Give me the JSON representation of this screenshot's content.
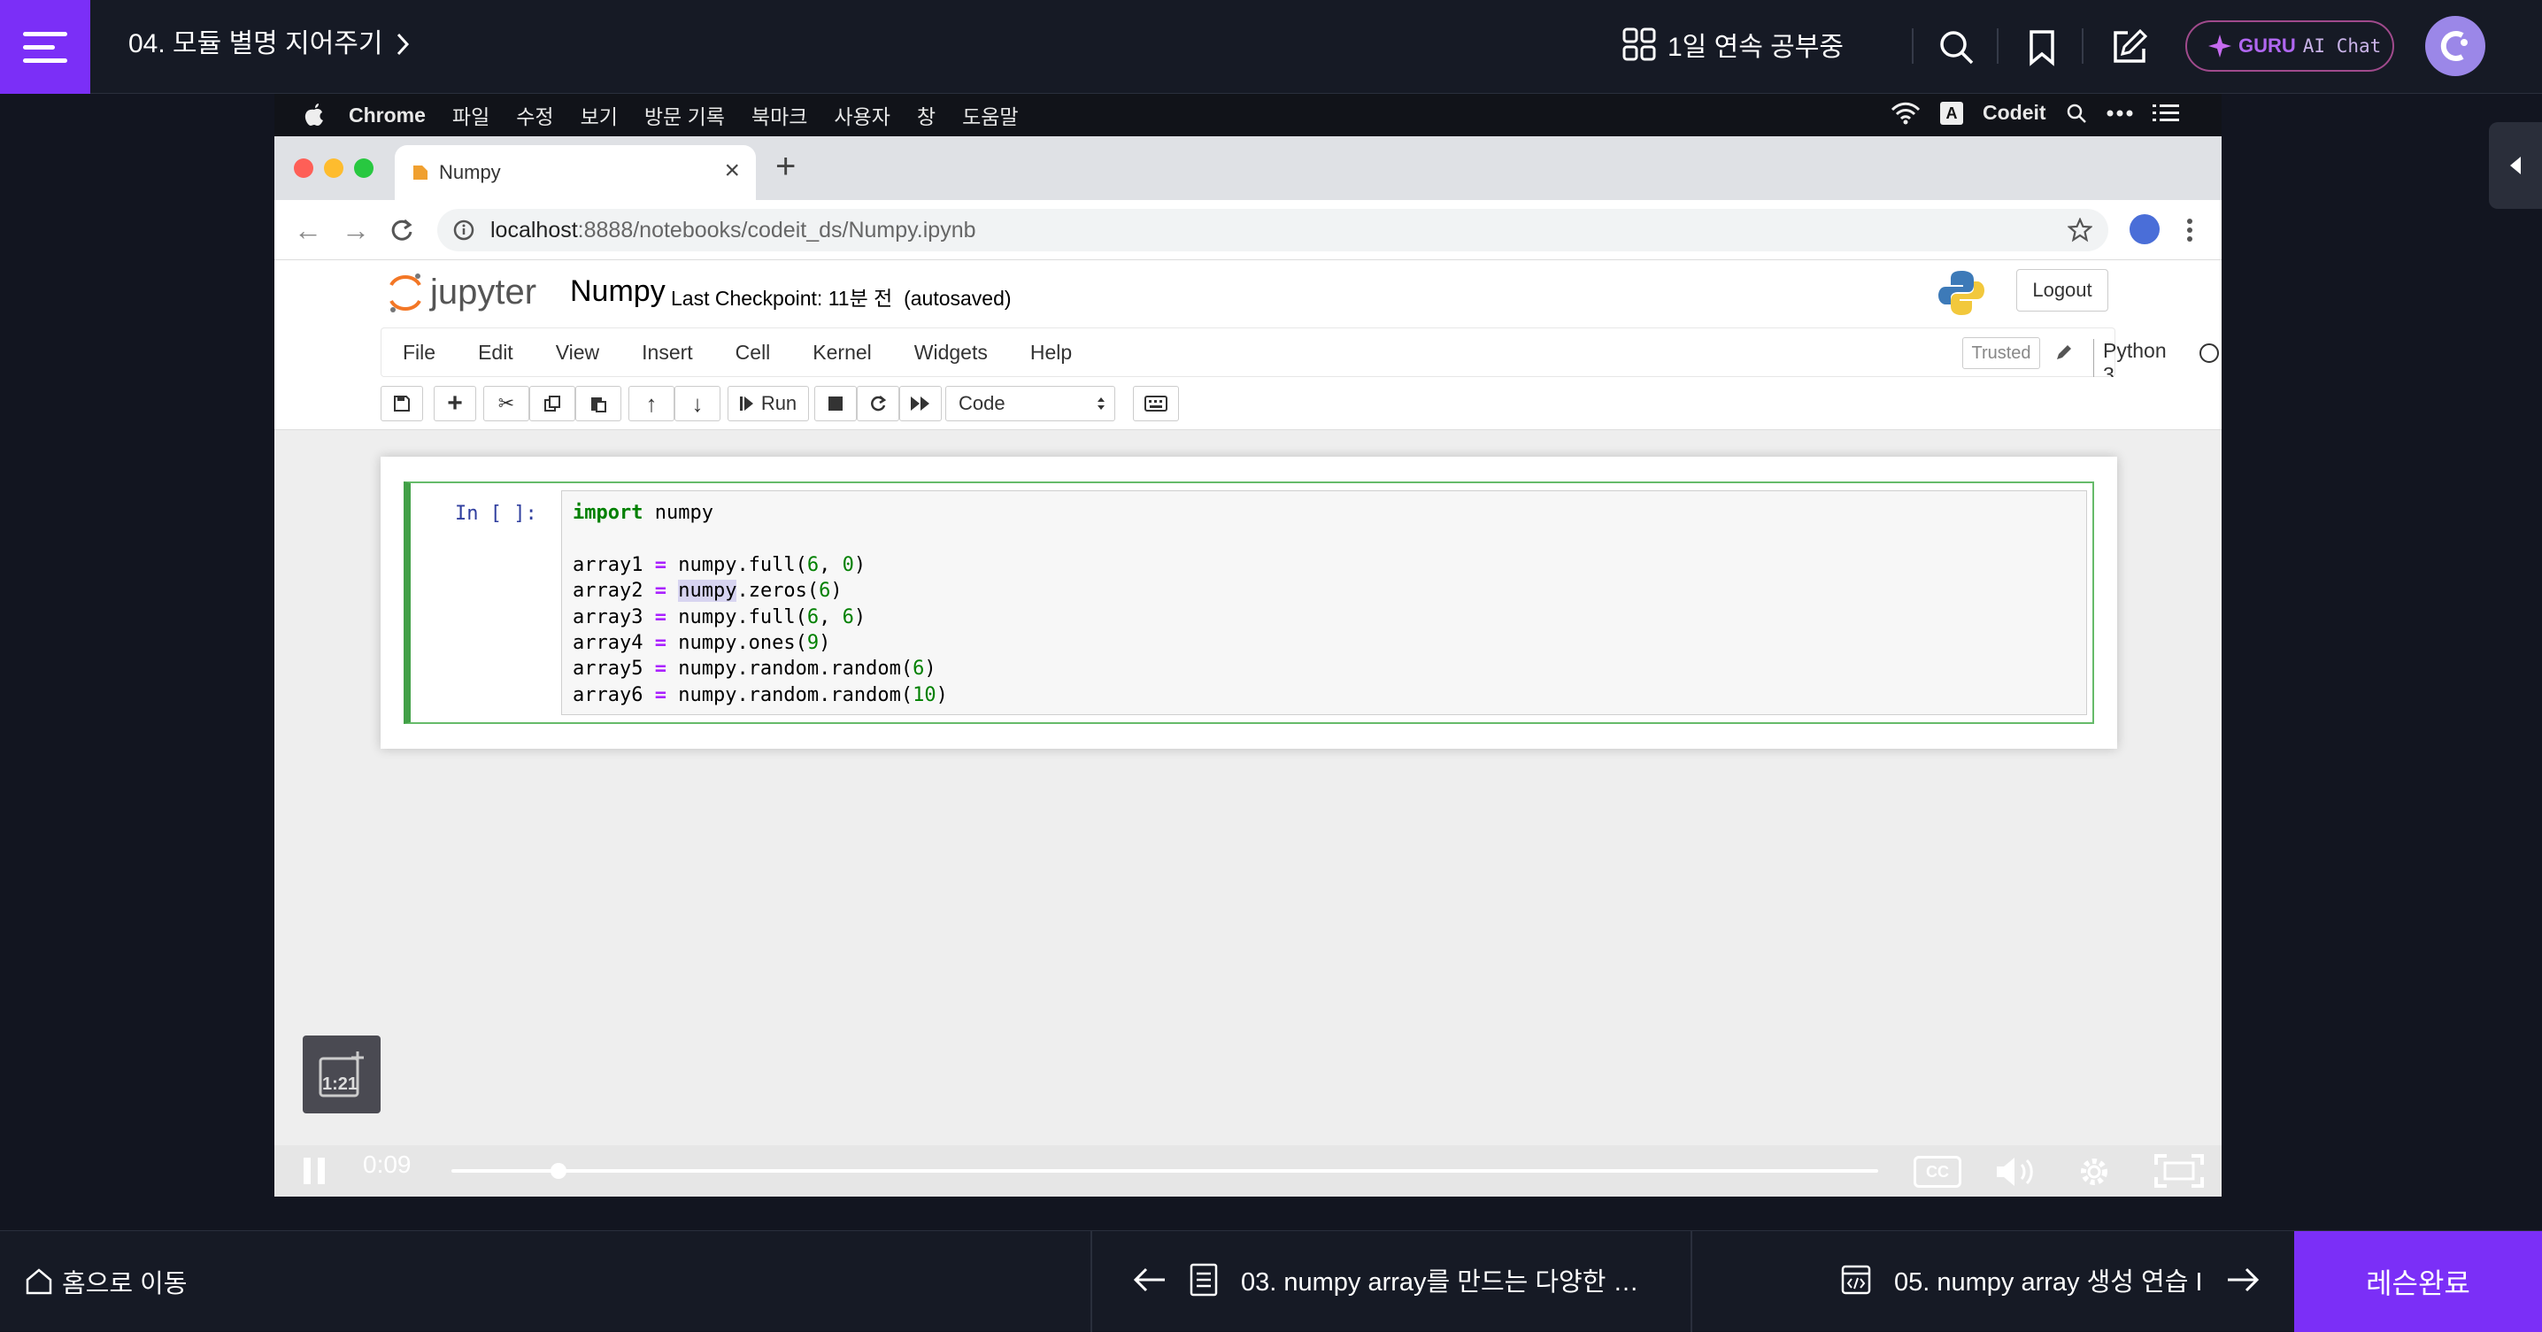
{
  "topbar": {
    "lesson_title": "04. 모듈 별명 지어주기",
    "streak": "1일 연속 공부중",
    "guru_brand": "GURU",
    "guru_label": "AI Chat"
  },
  "macbar": {
    "app": "Chrome",
    "menus": [
      "파일",
      "수정",
      "보기",
      "방문 기록",
      "북마크",
      "사용자",
      "창",
      "도움말"
    ],
    "right_label": "Codeit",
    "input_icon": "A"
  },
  "browser": {
    "tab_title": "Numpy",
    "url_host": "localhost",
    "url_path": ":8888/notebooks/codeit_ds/Numpy.ipynb"
  },
  "jupyter": {
    "logo_text": "jupyter",
    "notebook_name": "Numpy",
    "checkpoint": "Last Checkpoint: 11분 전",
    "autosaved": "(autosaved)",
    "logout": "Logout",
    "menus": [
      "File",
      "Edit",
      "View",
      "Insert",
      "Cell",
      "Kernel",
      "Widgets",
      "Help"
    ],
    "trusted": "Trusted",
    "kernel": "Python 3",
    "run_label": "Run",
    "cell_type": "Code",
    "prompt": "In [ ]:",
    "code_lines": [
      "import numpy",
      "",
      "array1 = numpy.full(6, 0)",
      "array2 = numpy.zeros(6)",
      "array3 = numpy.full(6, 6)",
      "array4 = numpy.ones(9)",
      "array5 = numpy.random.random(6)",
      "array6 = numpy.random.random(10)"
    ]
  },
  "video": {
    "time": "0:09",
    "thumb_time": "1:21",
    "progress": 0.075,
    "cc": "CC"
  },
  "bottombar": {
    "home": "홈으로 이동",
    "prev": "03. numpy array를 만드는 다양한 …",
    "next": "05. numpy array 생성 연습 I",
    "complete": "레슨완료"
  },
  "colors": {
    "accent": "#7b2ff7",
    "cell_border": "#42a047"
  }
}
